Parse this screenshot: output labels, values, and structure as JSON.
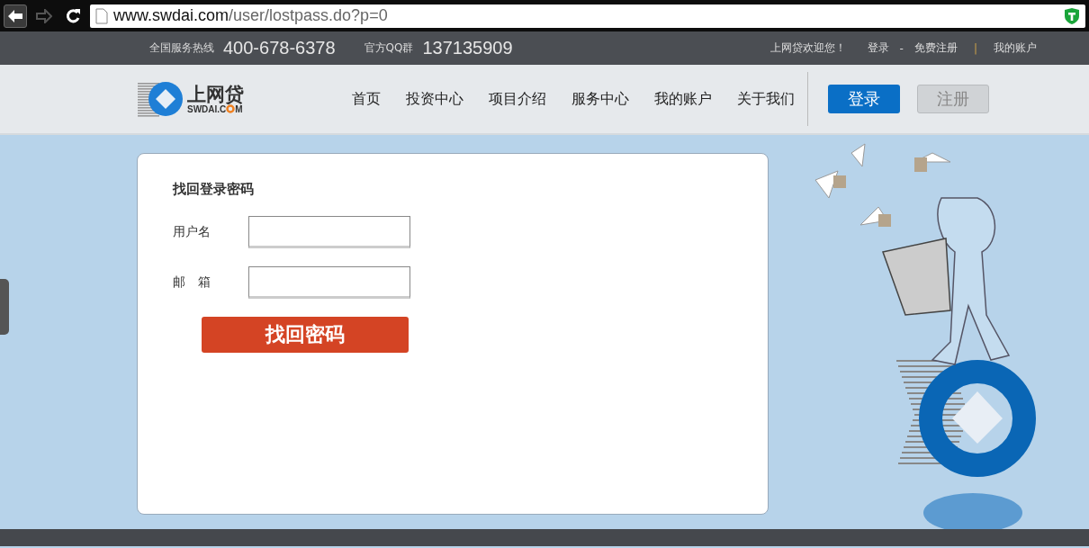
{
  "browser": {
    "url_host": "www.swdai.com",
    "url_path": "/user/lostpass.do?p=0"
  },
  "topbar": {
    "hotline_label": "全国服务热线",
    "hotline": "400-678-6378",
    "qq_label": "官方QQ群",
    "qq": "137135909",
    "welcome": "上网贷欢迎您！",
    "login": "登录",
    "dash": "-",
    "register": "免费注册",
    "separator": "|",
    "account": "我的账户"
  },
  "header": {
    "logo_name": "上网贷",
    "logo_domain_a": "SWDAI.C",
    "logo_domain_b": "M",
    "nav": [
      "首页",
      "投资中心",
      "项目介绍",
      "服务中心",
      "我的账户",
      "关于我们"
    ],
    "login_button": "登录",
    "register_button": "注册"
  },
  "form": {
    "title": "找回登录密码",
    "fields": [
      {
        "label": "用户名"
      },
      {
        "label": "邮　箱"
      }
    ],
    "submit": "找回密码"
  }
}
